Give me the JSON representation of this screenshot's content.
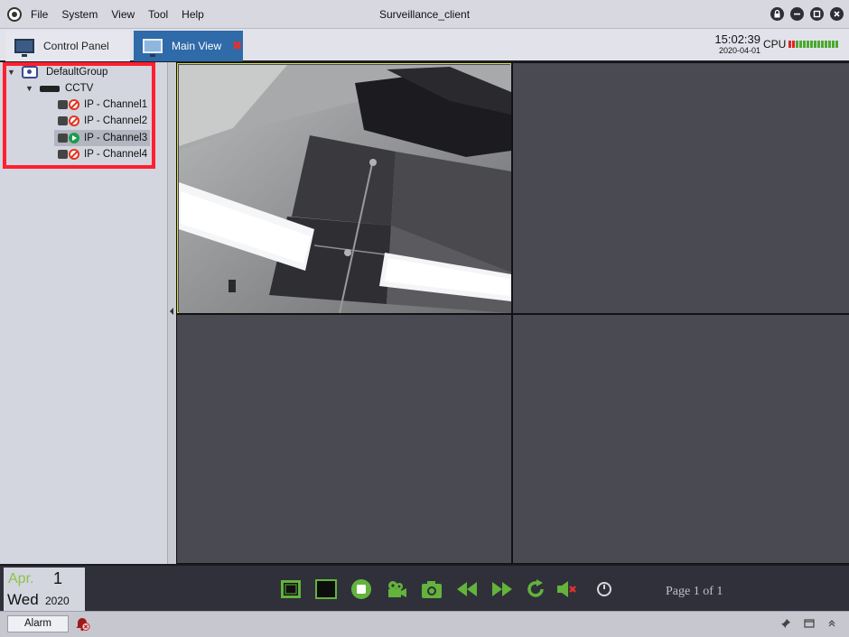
{
  "titlebar": {
    "title": "Surveillance_client",
    "menu": [
      "File",
      "System",
      "View",
      "Tool",
      "Help"
    ],
    "buttons": [
      "lock",
      "minimize",
      "maximize",
      "close"
    ]
  },
  "tabs": [
    {
      "label": "Control Panel",
      "active": false
    },
    {
      "label": "Main View",
      "active": true,
      "close": "✖"
    }
  ],
  "clock": {
    "time": "15:02:39",
    "date": "2020-04-01"
  },
  "cpu": {
    "label": "CPU"
  },
  "tree": {
    "group": "DefaultGroup",
    "device": "CCTV",
    "channels": [
      {
        "label": "IP - Channel1",
        "status": "offline"
      },
      {
        "label": "IP - Channel2",
        "status": "offline"
      },
      {
        "label": "IP - Channel3",
        "status": "playing"
      },
      {
        "label": "IP - Channel4",
        "status": "offline"
      }
    ]
  },
  "datebox": {
    "month": "Apr.",
    "day": "1",
    "weekday": "Wed",
    "year": "2020"
  },
  "controls": [
    "fullscreen-icon",
    "single-view-icon",
    "stop-icon",
    "record-icon",
    "snapshot-icon",
    "rewind-icon",
    "fast-forward-icon",
    "refresh-icon",
    "mute-icon",
    "timer-icon"
  ],
  "pagination": {
    "text": "Page 1 of 1"
  },
  "statusbar": {
    "alarm_label": "Alarm"
  },
  "colors": {
    "accent": "#2f6aa9",
    "highlight": "#ff1f2f",
    "active_cell_border": "#d8e049",
    "green_control": "#63b33c"
  }
}
